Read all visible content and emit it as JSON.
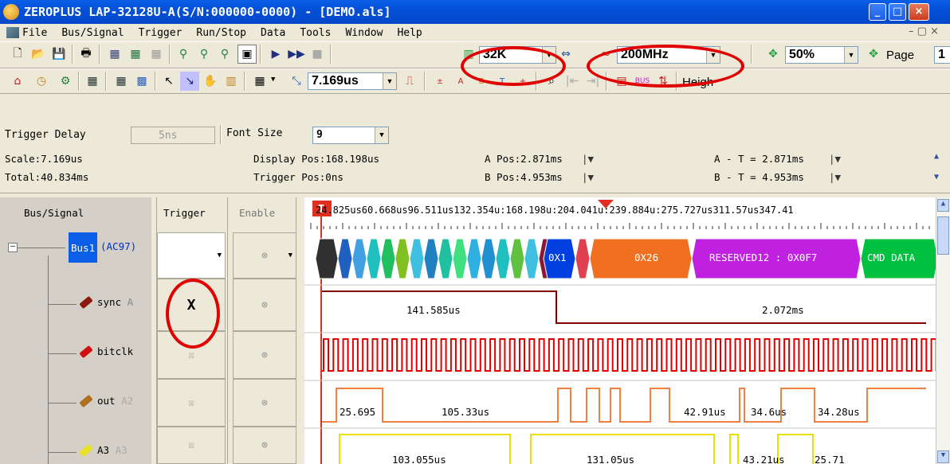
{
  "window": {
    "title": "ZEROPLUS LAP-32128U-A(S/N:000000-0000) - [DEMO.als]",
    "minimize": "_",
    "maximize": "□",
    "close": "×"
  },
  "menu": [
    "File",
    "Bus/Signal",
    "Trigger",
    "Run/Stop",
    "Data",
    "Tools",
    "Window",
    "Help"
  ],
  "toolbar1": {
    "memory_depth": "32K",
    "sample_rate": "200MHz",
    "zoom": "50%",
    "page_label": "Page",
    "page_value": "1"
  },
  "toolbar2": {
    "scale_value": "7.169us",
    "height_label": "Heigh"
  },
  "trigger_row": {
    "delay_label": "Trigger Delay",
    "delay_value": "5ns",
    "font_label": "Font Size",
    "font_value": "9"
  },
  "info": {
    "scale": "Scale:7.169us",
    "total": "Total:40.834ms",
    "display_pos": "Display Pos:168.198us",
    "trigger_pos": "Trigger Pos:0ns",
    "a_pos": "A Pos:2.871ms",
    "b_pos": "B Pos:4.953ms",
    "a_t": "A - T = 2.871ms",
    "b_t": "B - T = 4.953ms"
  },
  "columns": {
    "bus_signal": "Bus/Signal",
    "trigger": "Trigger",
    "enable": "Enable"
  },
  "signals": [
    {
      "name": "Bus1",
      "extra": "(AC97)"
    },
    {
      "name": "sync",
      "extra": "A"
    },
    {
      "name": "bitclk",
      "extra": ""
    },
    {
      "name": "out",
      "extra": "A2"
    },
    {
      "name": "A3",
      "extra": "A3"
    }
  ],
  "trigger_marker": "T",
  "trigger_symbol": "X",
  "time_ruler": "24.825us60.668us96.511us132.354u:168.198u:204.041u:239.884u:275.727us311.57us347.41",
  "bus_segments": [
    "0X1",
    "0X26",
    "RESERVED12 : 0X0F7",
    "CMD DATA"
  ],
  "sync_labels": [
    "141.585us",
    "2.072ms"
  ],
  "out_labels": [
    "25.695",
    "105.33us",
    "42.91us",
    "34.6us",
    "34.28us"
  ],
  "a3_labels": [
    "103.055us",
    "131.05us",
    "43.21us",
    "25.71"
  ],
  "colors": {
    "titlebar": "#0550d8",
    "bus_green": "#00c040",
    "bus_orange": "#f07020",
    "bus_magenta": "#c020e0",
    "bus_blue": "#0040e0",
    "sync_wave": "#800000",
    "bitclk_wave": "#e00000",
    "out_wave": "#f08040",
    "a3_wave": "#e0e000",
    "annotation": "#e10000"
  }
}
